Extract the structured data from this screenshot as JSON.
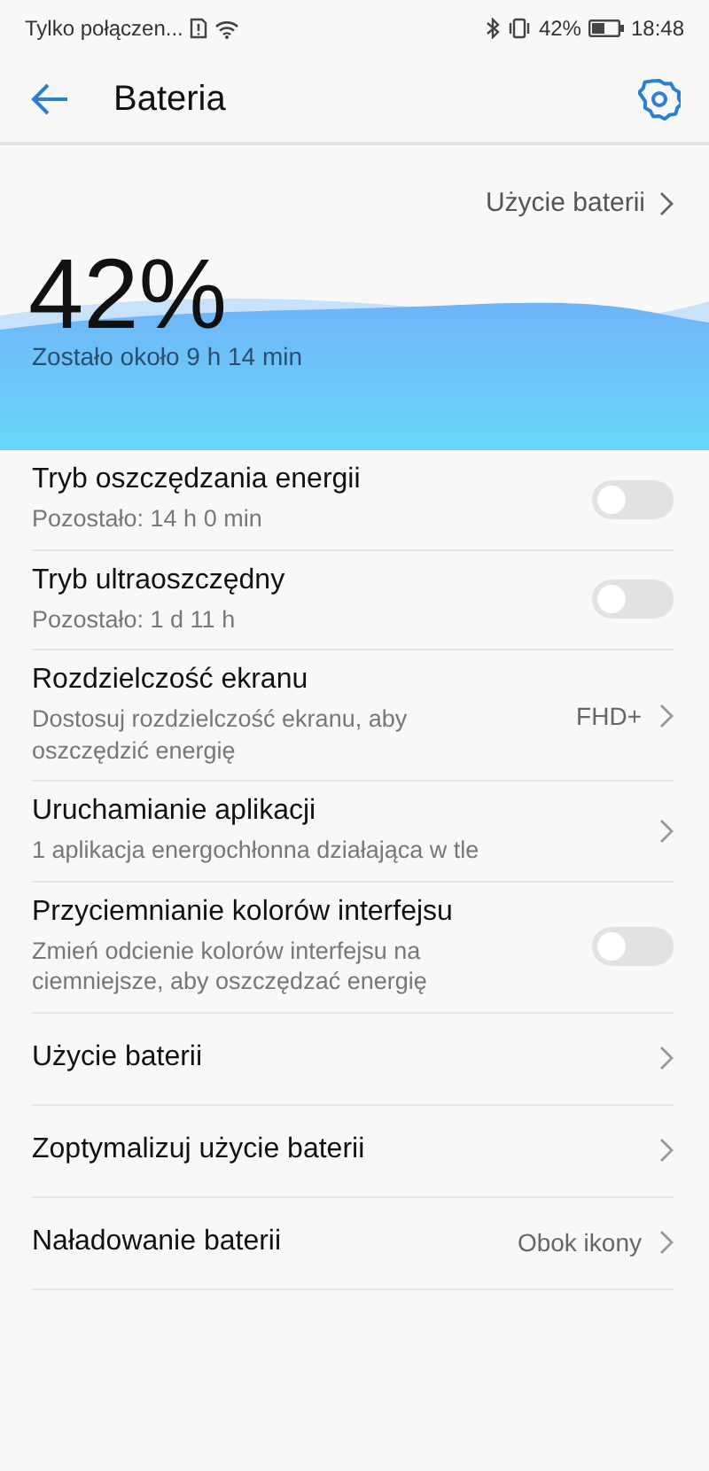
{
  "status_bar": {
    "carrier": "Tylko połączen...",
    "battery": "42%",
    "time": "18:48"
  },
  "header": {
    "title": "Bateria"
  },
  "hero": {
    "link": "Użycie baterii",
    "percent": "42%",
    "remaining": "Zostało około 9 h 14 min"
  },
  "rows": [
    {
      "kind": "toggle",
      "title": "Tryb oszczędzania energii",
      "subtitle": "Pozostało: 14 h 0 min",
      "on": false
    },
    {
      "kind": "toggle",
      "title": "Tryb ultraoszczędny",
      "subtitle": "Pozostało: 1 d 11 h",
      "on": false
    },
    {
      "kind": "link",
      "title": "Rozdzielczość ekranu",
      "subtitle": "Dostosuj rozdzielczość ekranu, aby oszczędzić energię",
      "value": "FHD+"
    },
    {
      "kind": "link",
      "title": "Uruchamianie aplikacji",
      "subtitle": "1 aplikacja energochłonna działająca w tle"
    },
    {
      "kind": "toggle",
      "title": "Przyciemnianie kolorów interfejsu",
      "subtitle": "Zmień odcienie kolorów interfejsu na ciemniejsze, aby oszczędzać energię",
      "on": false
    },
    {
      "kind": "link",
      "title": "Użycie baterii"
    },
    {
      "kind": "link",
      "title": "Zoptymalizuj użycie baterii"
    },
    {
      "kind": "link",
      "title": "Naładowanie baterii",
      "value": "Obok ikony"
    }
  ]
}
